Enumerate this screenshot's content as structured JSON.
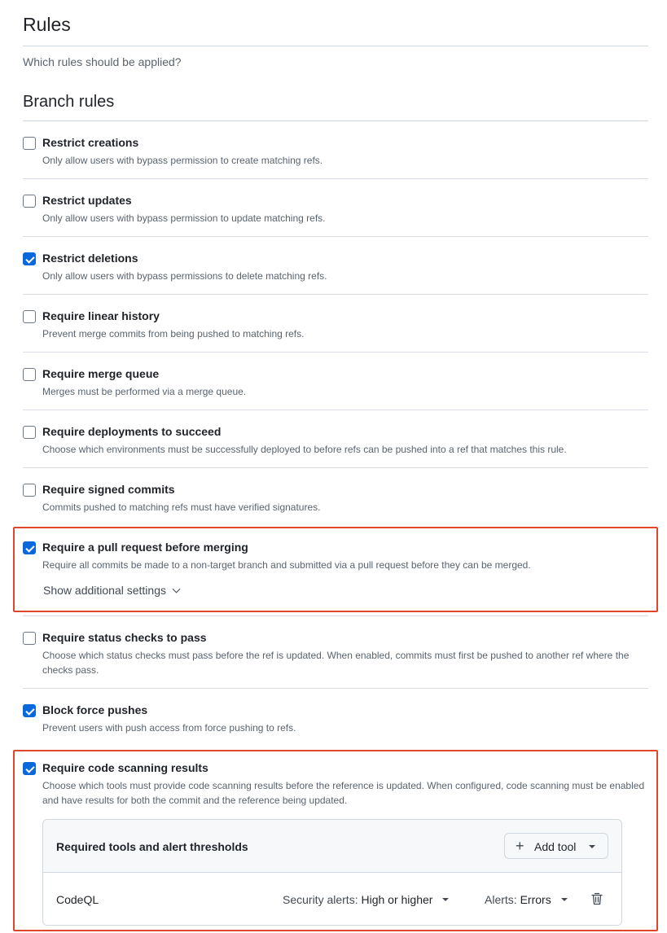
{
  "header": {
    "title": "Rules",
    "subtitle": "Which rules should be applied?"
  },
  "section": {
    "title": "Branch rules"
  },
  "rules": [
    {
      "title": "Restrict creations",
      "description": "Only allow users with bypass permission to create matching refs.",
      "checked": false
    },
    {
      "title": "Restrict updates",
      "description": "Only allow users with bypass permission to update matching refs.",
      "checked": false
    },
    {
      "title": "Restrict deletions",
      "description": "Only allow users with bypass permissions to delete matching refs.",
      "checked": true
    },
    {
      "title": "Require linear history",
      "description": "Prevent merge commits from being pushed to matching refs.",
      "checked": false
    },
    {
      "title": "Require merge queue",
      "description": "Merges must be performed via a merge queue.",
      "checked": false
    },
    {
      "title": "Require deployments to succeed",
      "description": "Choose which environments must be successfully deployed to before refs can be pushed into a ref that matches this rule.",
      "checked": false
    },
    {
      "title": "Require signed commits",
      "description": "Commits pushed to matching refs must have verified signatures.",
      "checked": false
    },
    {
      "title": "Require a pull request before merging",
      "description": "Require all commits be made to a non-target branch and submitted via a pull request before they can be merged.",
      "checked": true,
      "extra_link": "Show additional settings"
    },
    {
      "title": "Require status checks to pass",
      "description": "Choose which status checks must pass before the ref is updated. When enabled, commits must first be pushed to another ref where the checks pass.",
      "checked": false
    },
    {
      "title": "Block force pushes",
      "description": "Prevent users with push access from force pushing to refs.",
      "checked": true
    },
    {
      "title": "Require code scanning results",
      "description": "Choose which tools must provide code scanning results before the reference is updated. When configured, code scanning must be enabled and have results for both the commit and the reference being updated.",
      "checked": true
    }
  ],
  "code_scanning": {
    "box_title": "Required tools and alert thresholds",
    "add_tool_label": "Add tool",
    "tools": [
      {
        "name": "CodeQL",
        "security_alerts_label": "Security alerts:",
        "security_alerts_value": "High or higher",
        "alerts_label": "Alerts:",
        "alerts_value": "Errors"
      }
    ]
  },
  "colors": {
    "accent": "#0969da",
    "highlight": "#e0462c"
  },
  "icons": {
    "add": "plus-icon",
    "dropdown": "triangle-down-icon",
    "expand": "chevron-down-icon",
    "delete": "trash-icon"
  }
}
